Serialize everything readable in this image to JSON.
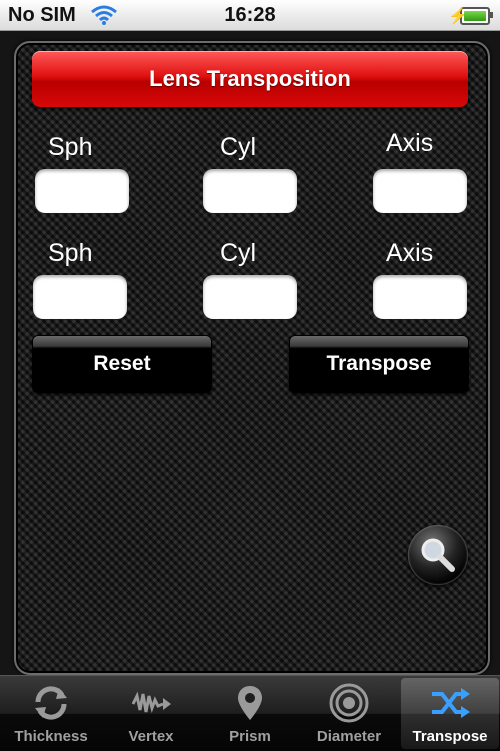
{
  "status": {
    "carrier": "No SIM",
    "time": "16:28",
    "wifi_icon": "wifi-icon",
    "battery_icon": "battery-charging-icon"
  },
  "title": "Lens Transposition",
  "rows": [
    {
      "labels": {
        "sph": "Sph",
        "cyl": "Cyl",
        "axis": "Axis"
      },
      "values": {
        "sph": "",
        "cyl": "",
        "axis": ""
      }
    },
    {
      "labels": {
        "sph": "Sph",
        "cyl": "Cyl",
        "axis": "Axis"
      },
      "values": {
        "sph": "",
        "cyl": "",
        "axis": ""
      }
    }
  ],
  "buttons": {
    "reset": "Reset",
    "transpose": "Transpose"
  },
  "search_icon": "magnifier-icon",
  "tabs": [
    {
      "label": "Thickness",
      "icon": "refresh-icon",
      "active": false
    },
    {
      "label": "Vertex",
      "icon": "wave-icon",
      "active": false
    },
    {
      "label": "Prism",
      "icon": "pin-icon",
      "active": false
    },
    {
      "label": "Diameter",
      "icon": "target-icon",
      "active": false
    },
    {
      "label": "Transpose",
      "icon": "shuffle-icon",
      "active": true
    }
  ],
  "colors": {
    "title_red": "#d80808",
    "active_tab_icon": "#3aa0ff"
  }
}
